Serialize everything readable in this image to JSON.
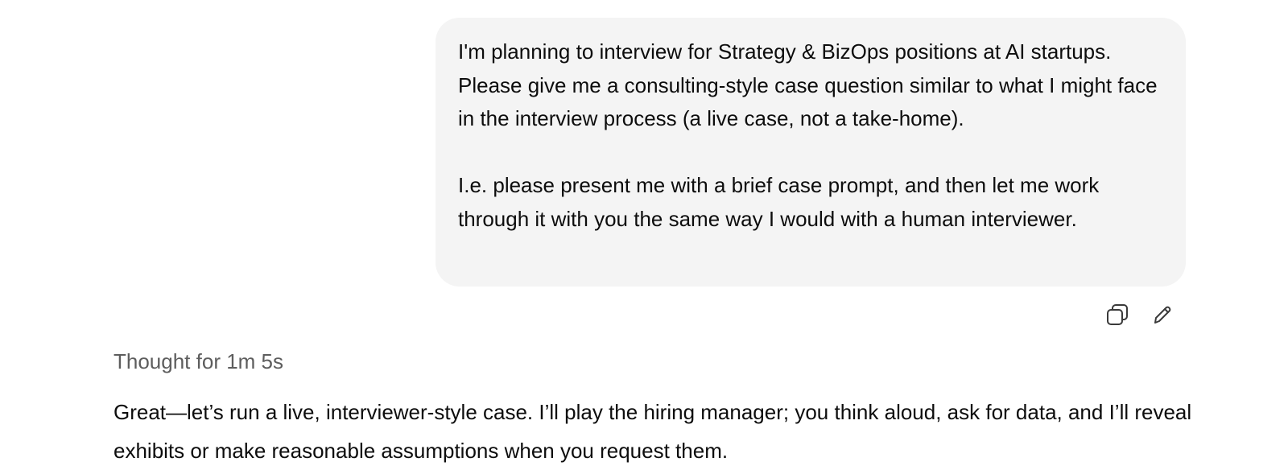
{
  "user_message": {
    "paragraphs": [
      "I'm planning to interview for Strategy & BizOps positions at AI startups. Please give me a consulting-style case question similar to what I might face in the interview process (a live case, not a take-home).",
      "I.e. please present me with a brief case prompt, and then let me work through it with you the same way I would with a human interviewer."
    ]
  },
  "message_actions": {
    "copy_icon": "copy-icon",
    "edit_icon": "pencil-icon"
  },
  "assistant": {
    "thought_label": "Thought for 1m 5s",
    "text": "Great—let’s run a live, interviewer-style case. I’ll play the hiring manager; you think aloud, ask for data, and I’ll reveal exhibits or make reasonable assumptions when you request them."
  },
  "colors": {
    "bubble_bg": "#f4f4f4",
    "text": "#0d0d0d",
    "muted": "#5d5d5d"
  }
}
